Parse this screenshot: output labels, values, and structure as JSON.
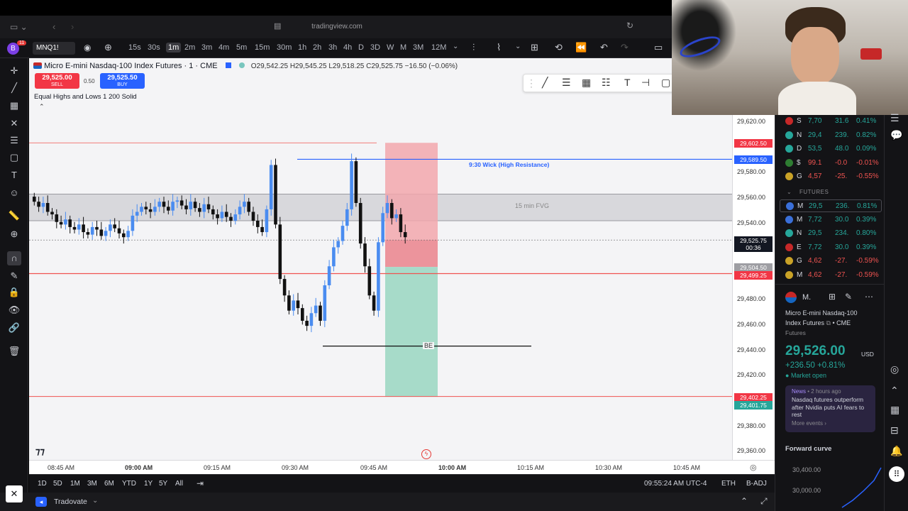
{
  "browser": {
    "url": "tradingview.com",
    "notif_badge": "11",
    "avatar_letter": "B"
  },
  "toolbar": {
    "symbol": "MNQ1!",
    "timeframes": [
      "15s",
      "30s",
      "1m",
      "2m",
      "3m",
      "4m",
      "5m",
      "15m",
      "30m",
      "1h",
      "2h",
      "3h",
      "4h",
      "3D",
      "D",
      "W",
      "M",
      "3M",
      "12M"
    ],
    "active_tf": "1m"
  },
  "chart": {
    "title": "Micro E-mini Nasdaq-100 Index Futures · 1 · CME",
    "ohlc": "O29,542.25 H29,545.25 L29,518.25 C29,525.75 −16.50 (−0.06%)",
    "sell_price": "29,525.00",
    "sell_label": "SELL",
    "spread": "0.50",
    "buy_price": "29,525.50",
    "buy_label": "BUY",
    "indicator": "Equal Highs and Lows 1 200 Solid",
    "wick_label": "9:30 Wick (High Resistance)",
    "fvg_label": "15 min FVG",
    "be_label": "BE",
    "price_ticks": [
      "29,620.00",
      "29,580.00",
      "29,560.00",
      "29,540.00",
      "29,480.00",
      "29,460.00",
      "29,440.00",
      "29,420.00",
      "29,380.00",
      "29,360.00"
    ],
    "price_labels": {
      "red_top": "29,602.50",
      "blue_line": "29,589.50",
      "last": "29,525.75",
      "countdown": "00:36",
      "gray": "29,504.50",
      "red_mid": "29,499.25",
      "red_bot": "29,402.25",
      "green_bot": "29,401.75"
    },
    "time_ticks": [
      "08:45 AM",
      "09:00 AM",
      "09:15 AM",
      "09:30 AM",
      "09:45 AM",
      "10:00 AM",
      "10:15 AM",
      "10:30 AM",
      "10:45 AM"
    ],
    "colors": {
      "up": "#4a8cf0",
      "down": "#111111",
      "stop": "#f2a7ad",
      "target": "#9fd8c4",
      "resistance": "#2962ff",
      "level": "#ef5350"
    }
  },
  "bottom": {
    "ranges": [
      "1D",
      "5D",
      "1M",
      "3M",
      "6M",
      "YTD",
      "1Y",
      "5Y",
      "All"
    ],
    "clock": "09:55:24 AM UTC-4",
    "session": "ETH",
    "adj": "B-ADJ"
  },
  "status": {
    "broker": "Tradovate"
  },
  "watchlist": {
    "rows": [
      {
        "sym": "S",
        "price": "7,70",
        "chg": "31.6",
        "pct": "0.41%",
        "dir": "pos",
        "color": "#c62828"
      },
      {
        "sym": "N",
        "price": "29,4",
        "chg": "239.",
        "pct": "0.82%",
        "dir": "pos",
        "color": "#26a69a"
      },
      {
        "sym": "D",
        "price": "53,5",
        "chg": "48.0",
        "pct": "0.09%",
        "dir": "pos",
        "color": "#26a69a"
      },
      {
        "sym": "$",
        "price": "99.1",
        "chg": "-0.0",
        "pct": "-0.01%",
        "dir": "neg",
        "color": "#2e7d32"
      },
      {
        "sym": "G",
        "price": "4,57",
        "chg": "-25.",
        "pct": "-0.55%",
        "dir": "neg",
        "color": "#c9a227"
      }
    ],
    "section": "FUTURES",
    "futures": [
      {
        "sym": "M",
        "price": "29,5",
        "chg": "236.",
        "pct": "0.81%",
        "dir": "pos",
        "color": "#3a6fd8"
      },
      {
        "sym": "M",
        "price": "7,72",
        "chg": "30.0",
        "pct": "0.39%",
        "dir": "pos",
        "color": "#3a6fd8"
      },
      {
        "sym": "N",
        "price": "29,5",
        "chg": "234.",
        "pct": "0.80%",
        "dir": "pos",
        "color": "#26a69a"
      },
      {
        "sym": "E",
        "price": "7,72",
        "chg": "30.0",
        "pct": "0.39%",
        "dir": "pos",
        "color": "#c62828"
      },
      {
        "sym": "G",
        "price": "4,62",
        "chg": "-27.",
        "pct": "-0.59%",
        "dir": "neg",
        "color": "#c9a227"
      },
      {
        "sym": "M",
        "price": "4,62",
        "chg": "-27.",
        "pct": "-0.59%",
        "dir": "neg",
        "color": "#c9a227"
      }
    ]
  },
  "details": {
    "short": "M.",
    "name_line1": "Micro E-mini Nasdaq-100",
    "name_line2": "Index Futures",
    "exchange": "CME",
    "category": "Futures",
    "price": "29,526.00",
    "currency": "USD",
    "change": "+236.50 +0.81%",
    "market": "Market open",
    "news_source": "News",
    "news_time": "2 hours ago",
    "news_text": "Nasdaq futures outperform after Nvidia puts AI fears to rest",
    "more_events": "More events ›",
    "forward_curve": "Forward curve",
    "fc_ticks": [
      "30,400.00",
      "30,000.00"
    ]
  }
}
